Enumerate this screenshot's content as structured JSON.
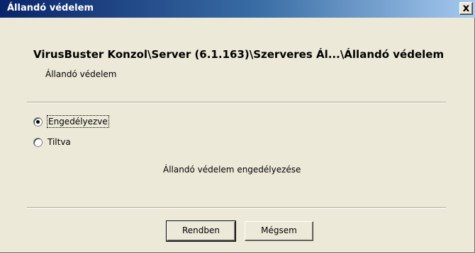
{
  "window": {
    "title": "Állandó védelem",
    "close_symbol": "x"
  },
  "header": {
    "path": "VirusBuster Konzol\\Server (6.1.163)\\Szerveres Ál...\\Állandó védelem",
    "subtitle": "Állandó védelem"
  },
  "options": [
    {
      "label": "Engedélyezve",
      "selected": true
    },
    {
      "label": "Tiltva",
      "selected": false
    }
  ],
  "description": "Állandó védelem engedélyezése",
  "buttons": {
    "ok_label": "Rendben",
    "cancel_label": "Mégsem"
  }
}
